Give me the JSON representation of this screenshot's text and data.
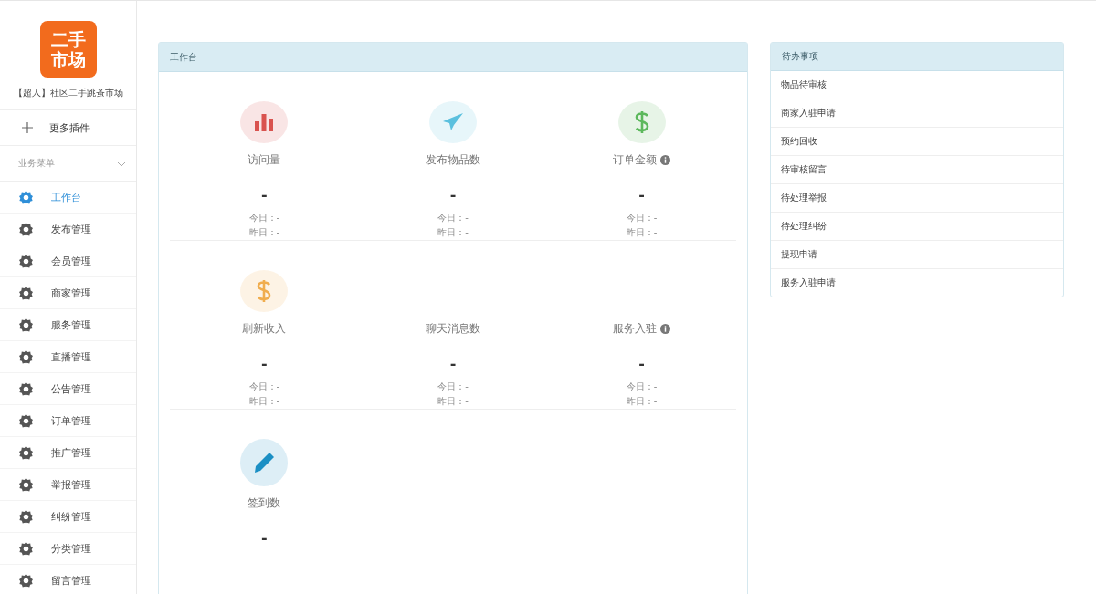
{
  "sidebar": {
    "logo": [
      "二手",
      "市场"
    ],
    "site_name": "【超人】社区二手跳蚤市场",
    "more_plugins": "更多插件",
    "section": {
      "label": "业务菜单",
      "expanded": true
    },
    "items": [
      {
        "label": "工作台",
        "selected": true
      },
      {
        "label": "发布管理",
        "selected": false
      },
      {
        "label": "会员管理",
        "selected": false
      },
      {
        "label": "商家管理",
        "selected": false
      },
      {
        "label": "服务管理",
        "selected": false
      },
      {
        "label": "直播管理",
        "selected": false
      },
      {
        "label": "公告管理",
        "selected": false
      },
      {
        "label": "订单管理",
        "selected": false
      },
      {
        "label": "推广管理",
        "selected": false
      },
      {
        "label": "举报管理",
        "selected": false
      },
      {
        "label": "纠纷管理",
        "selected": false
      },
      {
        "label": "分类管理",
        "selected": false
      },
      {
        "label": "留言管理",
        "selected": false
      }
    ]
  },
  "workbench": {
    "title": "工作台",
    "stats": [
      {
        "kind": "chart",
        "color": "#d9534f",
        "label": "访问量",
        "info": false,
        "value": "-",
        "today": "今日：-",
        "yesterday": "昨日：-"
      },
      {
        "kind": "plane",
        "color": "#5bc0de",
        "label": "发布物品数",
        "info": false,
        "value": "-",
        "today": "今日：-",
        "yesterday": "昨日：-"
      },
      {
        "kind": "dollar",
        "color": "#5cb85c",
        "label": "订单金额",
        "info": true,
        "value": "-",
        "today": "今日：-",
        "yesterday": "昨日：-"
      },
      {
        "kind": "dollar",
        "color": "#f0ad4e",
        "label": "刷新收入",
        "info": false,
        "value": "-",
        "today": "今日：-",
        "yesterday": "昨日：-"
      },
      {
        "label": "聊天消息数",
        "info": false,
        "value": "-",
        "today": "今日：-",
        "yesterday": "昨日：-"
      },
      {
        "label": "服务入驻",
        "info": true,
        "value": "-",
        "today": "今日：-",
        "yesterday": "昨日：-"
      },
      {
        "kind": "pencil",
        "color": "#1b8fc4",
        "label": "签到数",
        "info": false,
        "value": "-"
      }
    ]
  },
  "todo": {
    "title": "待办事项",
    "items": [
      "物品待审核",
      "商家入驻申请",
      "预约回收",
      "待审核留言",
      "待处理举报",
      "待处理纠纷",
      "提现申请",
      "服务入驻申请"
    ]
  }
}
